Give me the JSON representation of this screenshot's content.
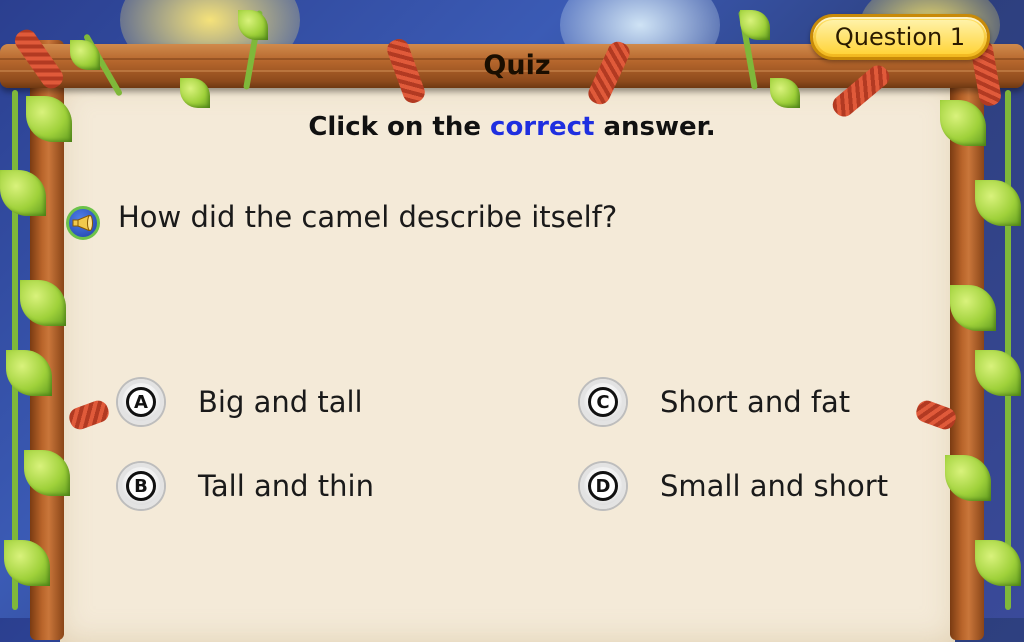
{
  "header": {
    "title": "Quiz",
    "question_badge": "Question 1"
  },
  "instruction": {
    "before": "Click on the ",
    "highlight": "correct",
    "after": " answer.",
    "highlight_color": "#1f2fe0"
  },
  "question": {
    "audio_icon": "speaker-horn-icon",
    "text": "How did the camel describe itself?"
  },
  "options": [
    {
      "letter": "A",
      "text": "Big and tall"
    },
    {
      "letter": "B",
      "text": "Tall and thin"
    },
    {
      "letter": "C",
      "text": "Short and fat"
    },
    {
      "letter": "D",
      "text": "Small and short"
    }
  ],
  "colors": {
    "panel": "#f4ead8",
    "wood": "#b5662c",
    "badge": "#ffd43a",
    "leaf": "#9fd13a",
    "rope": "#e05a3a"
  }
}
